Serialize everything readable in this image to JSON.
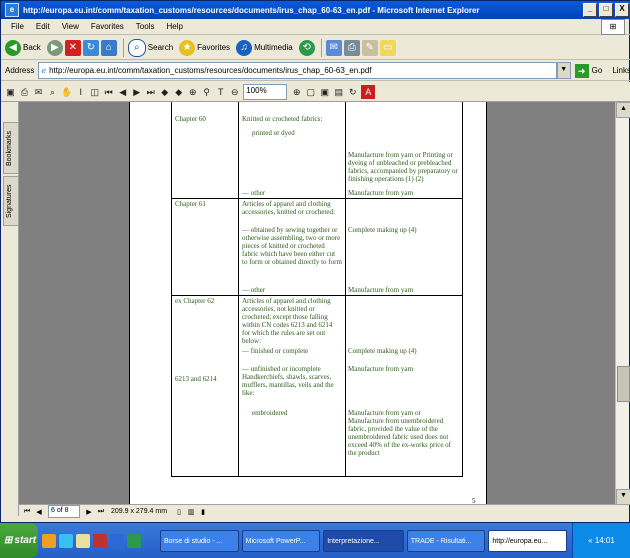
{
  "window": {
    "title": "http://europa.eu.int/comm/taxation_customs/resources/documents/irus_chap_60-63_en.pdf - Microsoft Internet Explorer",
    "controls": [
      "_",
      "□",
      "X"
    ]
  },
  "menu": [
    "File",
    "Edit",
    "View",
    "Favorites",
    "Tools",
    "Help"
  ],
  "navbar": {
    "back_label": "Back",
    "search_label": "Search",
    "favorites_label": "Favorites",
    "media_label": "Multimedia"
  },
  "address": {
    "label": "Address",
    "url": "http://europa.eu.int/comm/taxation_customs/resources/documents/irus_chap_60-63_en.pdf",
    "go_label": "Go",
    "links_label": "Links"
  },
  "pdf_toolbar": {
    "zoom": "100%"
  },
  "sidebar_tabs": [
    "Bookmarks",
    "Signatures"
  ],
  "status": {
    "page_field": "6 of 8",
    "page_size": "209.9 x 279.4 mm"
  },
  "document": {
    "page_number": "5",
    "rows": [
      {
        "heading": "Chapter 60",
        "desc": "Knitted or crocheted fabrics:",
        "entries": [
          {
            "desc": "printed or dyed",
            "rule": "Manufacture from yarn or Printing or dyeing of unbleached or prebleached fabrics, accompanied by preparatory or finishing operations (1) (2)"
          },
          {
            "desc": "— other",
            "rule": "Manufacture from yarn"
          }
        ]
      },
      {
        "heading": "Chapter 61",
        "desc": "Articles of apparel and clothing accessories, knitted or crocheted:",
        "entries": [
          {
            "desc": "— obtained by sewing together or otherwise assembling, two or more pieces of knitted or crocheted fabric which have been either cut to form or obtained directly to form",
            "rule": "Complete making up (4)"
          },
          {
            "desc": "— other",
            "rule": "Manufacture from yarn"
          }
        ]
      },
      {
        "heading": "ex Chapter 62",
        "desc": "Articles of apparel and clothing accessories, not knitted or crocheted; except those falling within CN codes 6213 and 6214 for which the rules are set out below:",
        "entries": [
          {
            "desc": "— finished or complete",
            "rule": "Complete making up (4)"
          },
          {
            "code": "6213 and 6214",
            "desc": "— unfinished or incomplete Handkerchiefs, shawls, scarves, mufflers, mantillas, veils and the like:",
            "rule": "Manufacture from yarn"
          },
          {
            "desc": "embroidered",
            "rule": "Manufacture from yarn or Manufacture from unembroidered fabric, provided the value of the unembroidered fabric used does not exceed 40% of the ex-works price of the product"
          }
        ]
      }
    ]
  },
  "taskbar": {
    "start_label": "start",
    "tasks": [
      "Borse di studio - ...",
      "Microsoft PowerP...",
      "Interpretazione...",
      "TRADE - Risultati...",
      "http://europa.eu..."
    ],
    "clock": "« 14:01"
  }
}
